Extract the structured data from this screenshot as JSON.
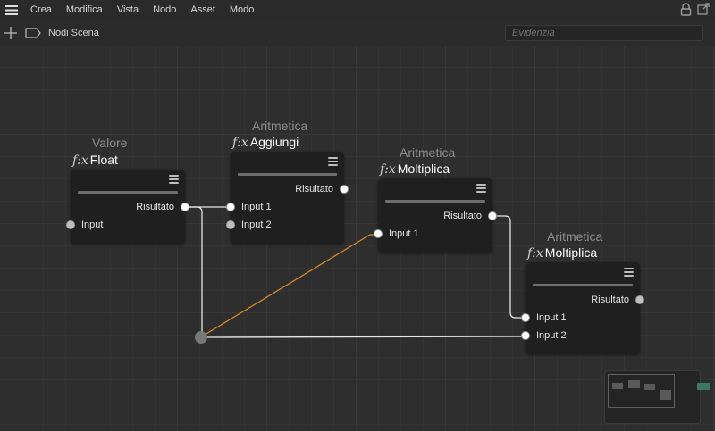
{
  "menubar": {
    "items": [
      "Crea",
      "Modifica",
      "Vista",
      "Nodo",
      "Asset",
      "Modo"
    ]
  },
  "toolbar": {
    "breadcrumb": "Nodi Scena",
    "search_placeholder": "Evidenzia"
  },
  "colors": {
    "wire_white": "#e8e8e8",
    "wire_orange": "#d58a2a",
    "node_bg": "#1f1f1f",
    "canvas_bg": "#2e2e2e"
  },
  "nodes": {
    "valore": {
      "type": "Valore",
      "fx": "f:x",
      "title": "Float",
      "output": "Risultato",
      "input1": "Input"
    },
    "aggiungi": {
      "type": "Aritmetica",
      "fx": "f:x",
      "title": "Aggiungi",
      "output": "Risultato",
      "input1": "Input 1",
      "input2": "Input 2"
    },
    "moltiplica1": {
      "type": "Aritmetica",
      "fx": "f:x",
      "title": "Moltiplica",
      "output": "Risultato",
      "input1": "Input 1"
    },
    "moltiplica2": {
      "type": "Aritmetica",
      "fx": "f:x",
      "title": "Moltiplica",
      "output": "Risultato",
      "input1": "Input 1",
      "input2": "Input 2"
    }
  }
}
